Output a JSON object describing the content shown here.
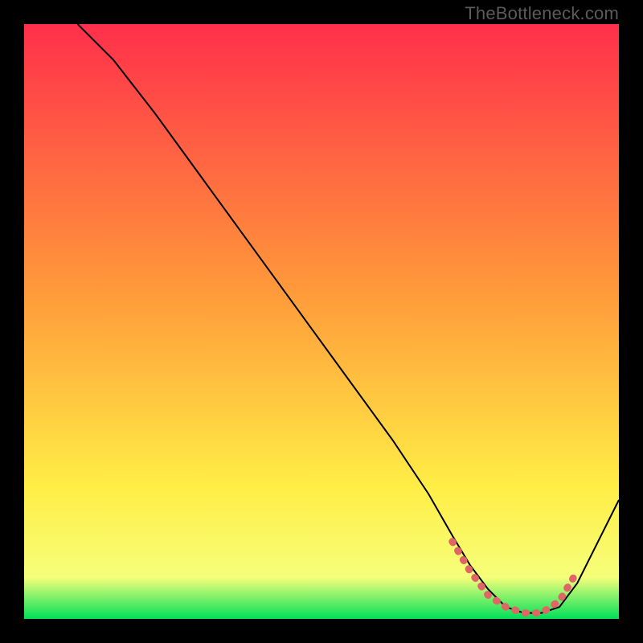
{
  "watermark": "TheBottleneck.com",
  "chart_data": {
    "type": "line",
    "title": "",
    "xlabel": "",
    "ylabel": "",
    "xlim": [
      0,
      100
    ],
    "ylim": [
      0,
      100
    ],
    "grid": false,
    "legend": false,
    "background_gradient": {
      "top": "#ff2f4b",
      "mid1": "#ff9a3a",
      "mid2": "#ffee46",
      "bottom": "#00e05a"
    },
    "series": [
      {
        "name": "bottleneck-curve",
        "color": "#000000",
        "stroke_width": 2,
        "x": [
          9,
          15,
          22,
          30,
          38,
          46,
          54,
          62,
          68,
          72,
          75,
          78,
          81,
          84,
          87,
          90,
          93,
          96,
          100
        ],
        "y": [
          100,
          94,
          85,
          74,
          63,
          52,
          41,
          30,
          21,
          14,
          9,
          5,
          2,
          1,
          1,
          2,
          6,
          12,
          20
        ]
      },
      {
        "name": "optimal-band-marker",
        "color": "#e06666",
        "stroke_width": 9,
        "dash": "1.2 12",
        "linecap": "round",
        "x": [
          72,
          75,
          78,
          81,
          84,
          87,
          90,
          93
        ],
        "y": [
          13,
          8,
          4,
          2,
          1,
          1,
          3,
          8
        ]
      }
    ]
  }
}
